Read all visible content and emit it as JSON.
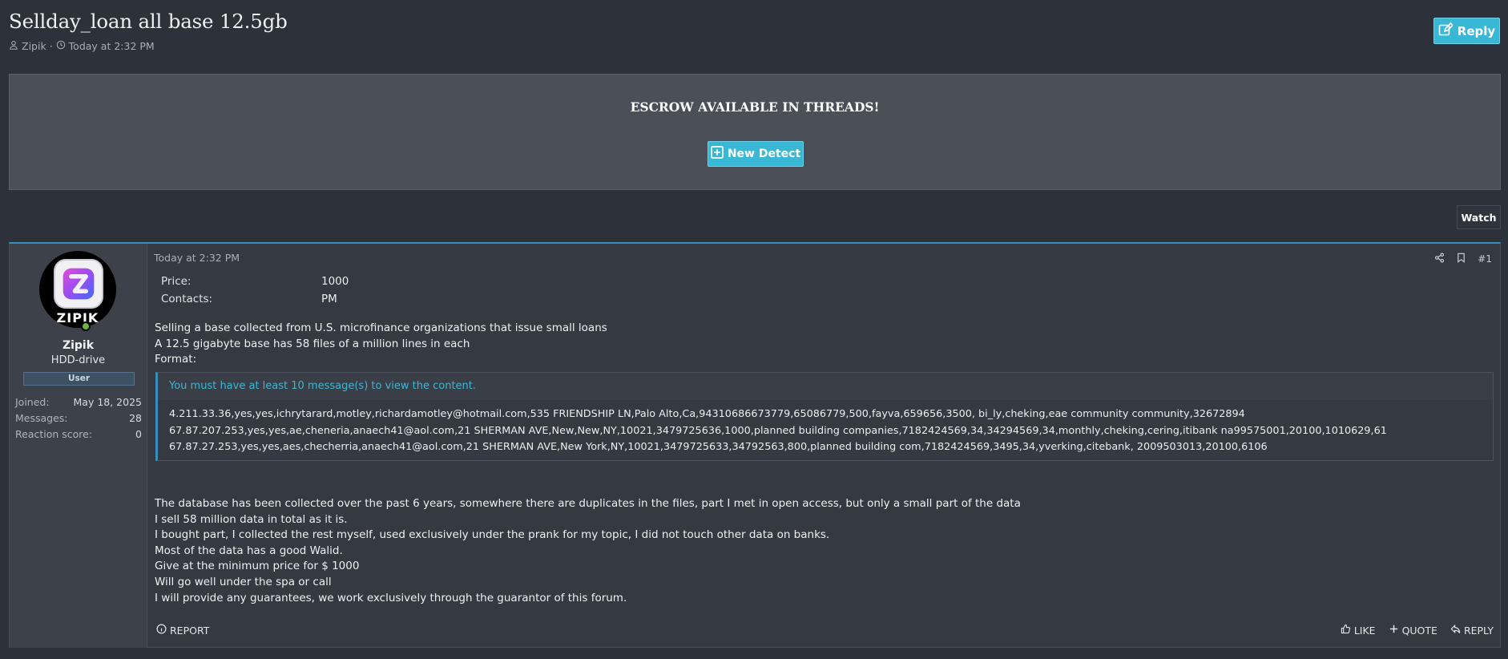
{
  "thread": {
    "title": "Sellday_loan all base 12.5gb",
    "author": "Zipik",
    "separator": "·",
    "date": "Today at 2:32 PM",
    "reply_label": "Reply"
  },
  "escrow": {
    "title": "ESCROW AVAILABLE IN THREADS!",
    "button_label": "New Detect"
  },
  "watch_label": "Watch",
  "post": {
    "user": {
      "avatar_text": "ZIPIK",
      "name": "Zipik",
      "title": "HDD-drive",
      "banner": "User",
      "stats": [
        {
          "label": "Joined:",
          "value": "May 18, 2025"
        },
        {
          "label": "Messages:",
          "value": "28"
        },
        {
          "label": "Reaction score:",
          "value": "0"
        }
      ]
    },
    "date": "Today at 2:32 PM",
    "number": "#1",
    "fields": [
      {
        "label": "Price:",
        "value": "1000"
      },
      {
        "label": "Contacts:",
        "value": "PM"
      }
    ],
    "intro": [
      "Selling a base collected from U.S. microfinance organizations that issue small loans",
      "A 12.5 gigabyte base has 58 files of a million lines in each",
      "Format:"
    ],
    "hidden_notice": "You must have at least 10 message(s) to view the content.",
    "sample_lines": [
      "4.211.33.36,yes,yes,ichrytarard,motley,richardamotley@hotmail.com,535 FRIENDSHIP LN,Palo Alto,Ca,94310686673779,65086779,500,fayva,659656,3500, bi_ly,cheking,eae community community,32672894",
      "67.87.207.253,yes,yes,ae,cheneria,anaech41@aol.com,21 SHERMAN AVE,New,New,NY,10021,3479725636,1000,planned building companies,7182424569,34,34294569,34,monthly,cheking,cering,itibank na99575001,20100,1010629,61",
      "67.87.27.253,yes,yes,aes,checherria,anaech41@aol.com,21 SHERMAN AVE,New York,NY,10021,3479725633,34792563,800,planned building com,7182424569,3495,34,yverking,citebank, 2009503013,20100,6106"
    ],
    "body": [
      "The database has been collected over the past 6 years, somewhere there are duplicates in the files, part I met in open access, but only a small part of the data",
      "I sell 58 million data in total as it is.",
      "I bought part, I collected the rest myself, used exclusively under the prank for my topic, I did not touch other data on banks.",
      "Most of the data has a good Walid.",
      "Give at the minimum price for $ 1000",
      "Will go well under the spa or call",
      "I will provide any guarantees, we work exclusively through the guarantor of this forum."
    ],
    "actions": {
      "report": "REPORT",
      "like": "LIKE",
      "quote": "QUOTE",
      "reply": "REPLY"
    }
  },
  "colors": {
    "accent": "#39b8d6",
    "background": "#2c313a",
    "panel": "#4a4f58",
    "post_border": "#3a8dc0",
    "online": "#6cb33f"
  },
  "icons": [
    "user-icon",
    "clock-icon",
    "edit-icon",
    "plus-square-icon",
    "share-icon",
    "bookmark-icon",
    "info-icon",
    "thumbs-up-icon",
    "plus-icon",
    "reply-icon"
  ]
}
